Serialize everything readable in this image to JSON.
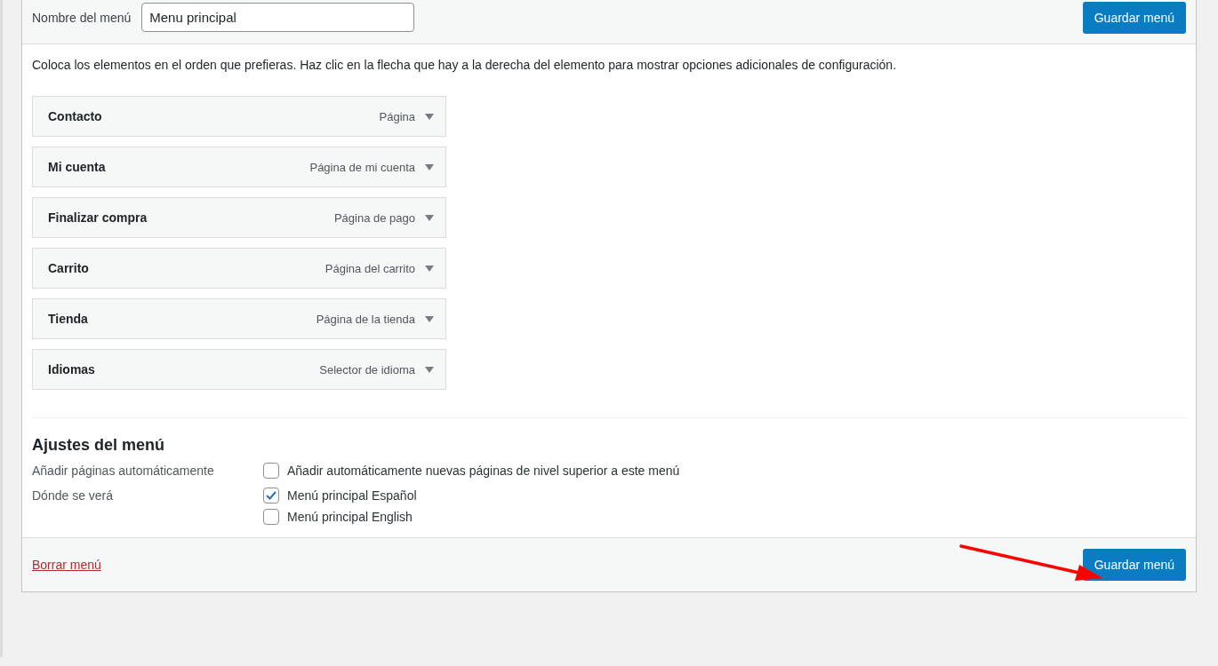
{
  "menu_name": {
    "label": "Nombre del menú",
    "value": "Menu principal"
  },
  "top_save_button": "Guardar menú",
  "instructions": "Coloca los elementos en el orden que prefieras. Haz clic en la flecha que hay a la derecha del elemento para mostrar opciones adicionales de configuración.",
  "items": [
    {
      "title": "Contacto",
      "type": "Página"
    },
    {
      "title": "Mi cuenta",
      "type": "Página de mi cuenta"
    },
    {
      "title": "Finalizar compra",
      "type": "Página de pago"
    },
    {
      "title": "Carrito",
      "type": "Página del carrito"
    },
    {
      "title": "Tienda",
      "type": "Página de la tienda"
    },
    {
      "title": "Idiomas",
      "type": "Selector de idioma"
    }
  ],
  "settings": {
    "title": "Ajustes del menú",
    "rows": [
      {
        "label": "Añadir páginas automáticamente",
        "options": [
          {
            "label": "Añadir automáticamente nuevas páginas de nivel superior a este menú",
            "checked": false
          }
        ]
      },
      {
        "label": "Dónde se verá",
        "options": [
          {
            "label": "Menú principal Español",
            "checked": true
          },
          {
            "label": "Menú principal English",
            "checked": false
          }
        ]
      }
    ]
  },
  "footer": {
    "delete_link": "Borrar menú",
    "save_button": "Guardar menú"
  }
}
